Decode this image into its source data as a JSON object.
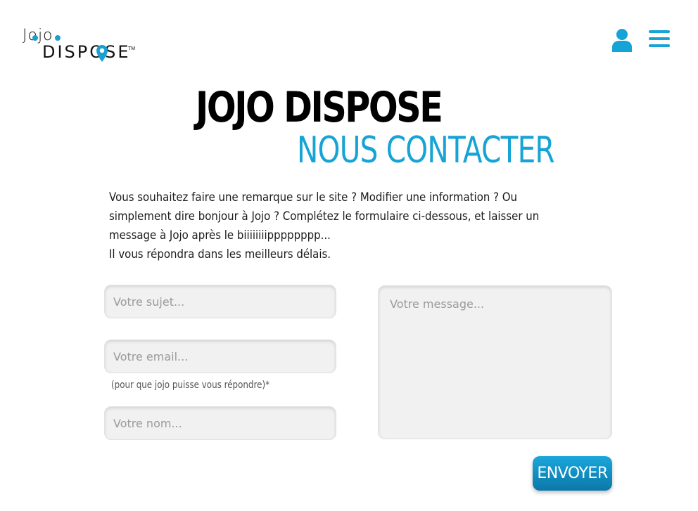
{
  "logo": {
    "line1": "Jojo",
    "line2": "DISPOSE",
    "tm": "TM"
  },
  "header": {
    "user_icon": "user-icon",
    "menu_icon": "hamburger-menu-icon"
  },
  "site_title": "JOJO DISPOSE",
  "page_title": "NOUS CONTACTER",
  "intro": {
    "line1": "Vous souhaitez faire une remarque sur le site ? Modifier une information ? Ou simplement dire bonjour à Jojo ? Complétez le formulaire ci-dessous, et laisser un message à Jojo après le biiiiiiiipppppppp...",
    "line2": "Il vous répondra dans les meilleurs délais."
  },
  "form": {
    "subject": {
      "placeholder": "Votre sujet...",
      "value": ""
    },
    "email": {
      "placeholder": "Votre email...",
      "value": "",
      "hint": "(pour que jojo puisse vous répondre)*"
    },
    "name": {
      "placeholder": "Votre nom...",
      "value": ""
    },
    "message": {
      "placeholder": "Votre message...",
      "value": ""
    },
    "submit_label": "ENVOYER"
  },
  "colors": {
    "accent": "#16a3d6",
    "title": "#000000"
  }
}
